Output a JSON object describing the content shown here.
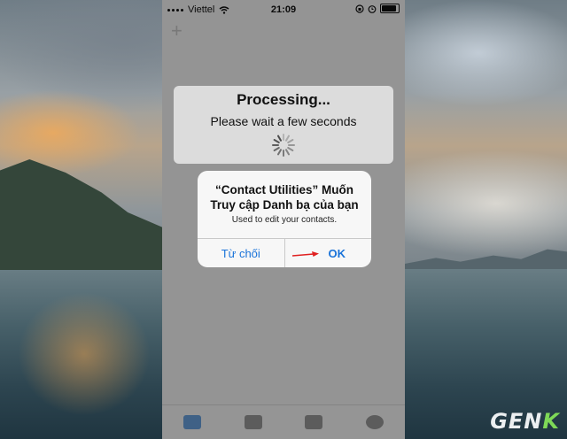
{
  "status_bar": {
    "carrier": "Viettel",
    "time": "21:09"
  },
  "processing": {
    "title": "Processing...",
    "message": "Please wait a few seconds"
  },
  "alert": {
    "title": "“Contact Utilities” Muốn Truy cập Danh bạ của bạn",
    "message": "Used to edit your contacts.",
    "deny_label": "Từ chối",
    "ok_label": "OK"
  },
  "watermark": {
    "text": "GEN",
    "accent": "K"
  },
  "colors": {
    "link_blue": "#1a73d9",
    "arrow_red": "#e02020"
  },
  "icons": {
    "add": "plus-icon",
    "wifi": "wifi-icon",
    "battery": "battery-icon",
    "annotation": "red-arrow-icon"
  }
}
